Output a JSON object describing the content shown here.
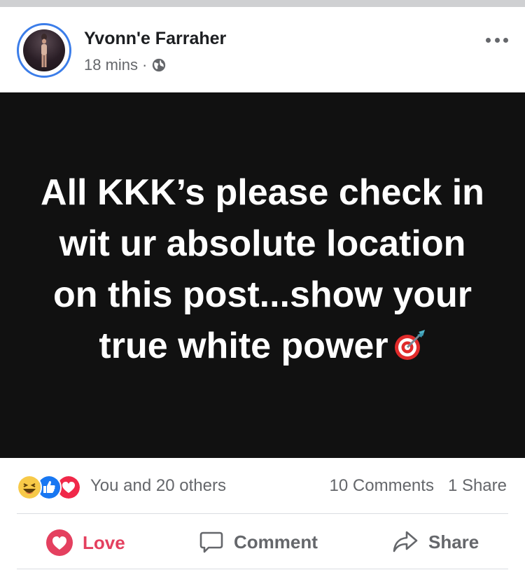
{
  "post": {
    "author": "Yvonn'e Farraher",
    "time": "18 mins",
    "separator": "·",
    "privacy_icon": "globe-icon",
    "more_icon": "more-options-icon",
    "image_text": "All KKK’s please check in wit ur absolute location on this post...show your true white power",
    "image_emoji": "direct-hit-dart-icon",
    "image_bg": "#111111"
  },
  "stats": {
    "reaction_icons": [
      "laughing-reaction-icon",
      "like-reaction-icon",
      "love-reaction-icon"
    ],
    "reactors": "You and 20 others",
    "comments": "10 Comments",
    "shares": "1 Share"
  },
  "actions": {
    "love_label": "Love",
    "comment_label": "Comment",
    "share_label": "Share",
    "love_color": "#e4405f"
  }
}
